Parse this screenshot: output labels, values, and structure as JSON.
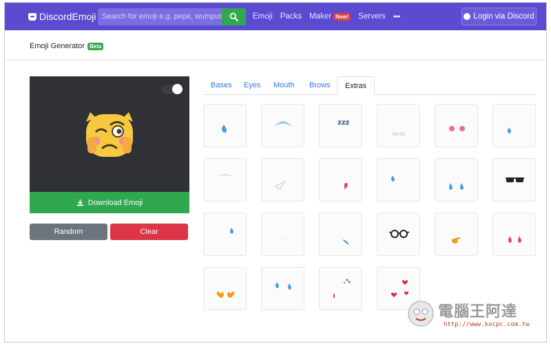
{
  "navbar": {
    "brand": "DiscordEmoji",
    "search_placeholder": "Search for emoji e.g. pepe, wumpus...",
    "links": [
      "Emoji",
      "Packs",
      "Maker"
    ],
    "new_badge": "New!",
    "servers": "Servers",
    "more": "•••",
    "login": "Login via Discord"
  },
  "page": {
    "title": "Emoji Generator",
    "beta_badge": "Beta"
  },
  "preview": {
    "download_label": "Download Emoji",
    "random_label": "Random",
    "clear_label": "Clear",
    "toggle_on": true
  },
  "tabs": [
    {
      "label": "Bases",
      "active": false
    },
    {
      "label": "Eyes",
      "active": false
    },
    {
      "label": "Mouth",
      "active": false
    },
    {
      "label": "Brows",
      "active": false
    },
    {
      "label": "Extras",
      "active": true
    }
  ],
  "extras": [
    {
      "name": "sweat-drop"
    },
    {
      "name": "halo"
    },
    {
      "name": "zzz",
      "text": "zzz"
    },
    {
      "name": "clouds"
    },
    {
      "name": "blush-dots"
    },
    {
      "name": "drop-right"
    },
    {
      "name": "tissue"
    },
    {
      "name": "paper-plane"
    },
    {
      "name": "tiny-heart"
    },
    {
      "name": "tear-left"
    },
    {
      "name": "tears"
    },
    {
      "name": "sunglasses"
    },
    {
      "name": "drop-low"
    },
    {
      "name": "steam"
    },
    {
      "name": "sweat-streak"
    },
    {
      "name": "glasses"
    },
    {
      "name": "pointing-hand"
    },
    {
      "name": "red-tears"
    },
    {
      "name": "hands"
    },
    {
      "name": "double-tears"
    },
    {
      "name": "sparkles"
    },
    {
      "name": "hearts"
    }
  ],
  "watermark": {
    "text": "電腦王阿達",
    "url": "http://www.kocpc.com.tw"
  },
  "colors": {
    "navbar": "#5b4bd1",
    "success": "#2fa84f",
    "danger": "#dc3545",
    "secondary": "#6c757d",
    "link": "#2f7ae0",
    "preview_bg": "#2f3136"
  }
}
